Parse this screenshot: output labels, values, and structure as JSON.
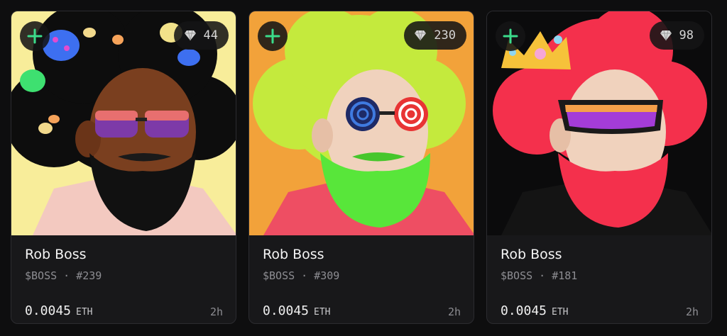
{
  "cards": [
    {
      "name": "Rob Boss",
      "ticker": "$BOSS",
      "separator": "·",
      "token_id": "#239",
      "price": "0.0045",
      "currency": "ETH",
      "time": "2h",
      "likes": "44",
      "bg_color": "#f8ed9a",
      "hair_color": "#0d0d0d",
      "beard_color": "#111111",
      "skin_color": "#7a3f1f",
      "shirt_color": "#f3c9c0"
    },
    {
      "name": "Rob Boss",
      "ticker": "$BOSS",
      "separator": "·",
      "token_id": "#309",
      "price": "0.0045",
      "currency": "ETH",
      "time": "2h",
      "likes": "230",
      "bg_color": "#f2a23a",
      "hair_color": "#c4ea3d",
      "beard_color": "#58e63a",
      "skin_color": "#f0d2bd",
      "shirt_color": "#ee4e63"
    },
    {
      "name": "Rob Boss",
      "ticker": "$BOSS",
      "separator": "·",
      "token_id": "#181",
      "price": "0.0045",
      "currency": "ETH",
      "time": "2h",
      "likes": "98",
      "bg_color": "#0b0b0c",
      "hair_color": "#f4304c",
      "beard_color": "#f4304c",
      "skin_color": "#f0d2bd",
      "shirt_color": "#141414"
    }
  ],
  "colors": {
    "accent_plus": "#3bdc8b",
    "diamond": "#d8d8d8"
  },
  "icons": {
    "add": "plus-icon",
    "likes": "diamond-icon"
  }
}
